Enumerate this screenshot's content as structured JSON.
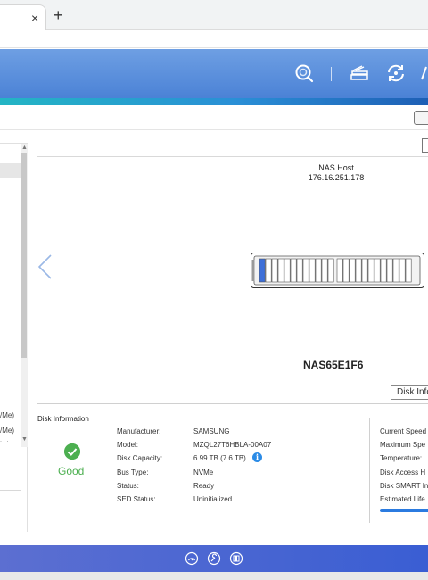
{
  "browser": {
    "close_tab_glyph": "×",
    "new_tab_glyph": "+"
  },
  "header_icons": [
    "search-icon",
    "storage-stack-icon",
    "sync-icon"
  ],
  "left_panel": {
    "row_texts": [
      "/Me)",
      "/Me)",
      "· · ·"
    ]
  },
  "viewer": {
    "host_label": "NAS Host",
    "host_ip": "176.16.251.178",
    "nas_name": "NAS65E1F6",
    "disk_info_button": "Disk Info"
  },
  "disk_information": {
    "title": "Disk Information",
    "status": "Good",
    "fields": [
      {
        "label": "Manufacturer:",
        "value": "SAMSUNG"
      },
      {
        "label": "Model:",
        "value": "MZQL27T6HBLA-00A07"
      },
      {
        "label": "Disk Capacity:",
        "value": "6.99 TB (7.6 TB)"
      },
      {
        "label": "Bus Type:",
        "value": "NVMe"
      },
      {
        "label": "Status:",
        "value": "Ready"
      },
      {
        "label": "SED Status:",
        "value": "Uninitialized"
      }
    ],
    "right_labels": [
      "Current Speed",
      "Maximum Spe",
      "Temperature:",
      "Disk Access H",
      "Disk SMART In",
      "Estimated Life"
    ]
  },
  "colors": {
    "header_blue": "#4b82d6",
    "accent_teal": "#23b5c4",
    "good_green": "#4caf50",
    "info_blue": "#2b8be6",
    "selected_slot": "#3d6fd8"
  }
}
